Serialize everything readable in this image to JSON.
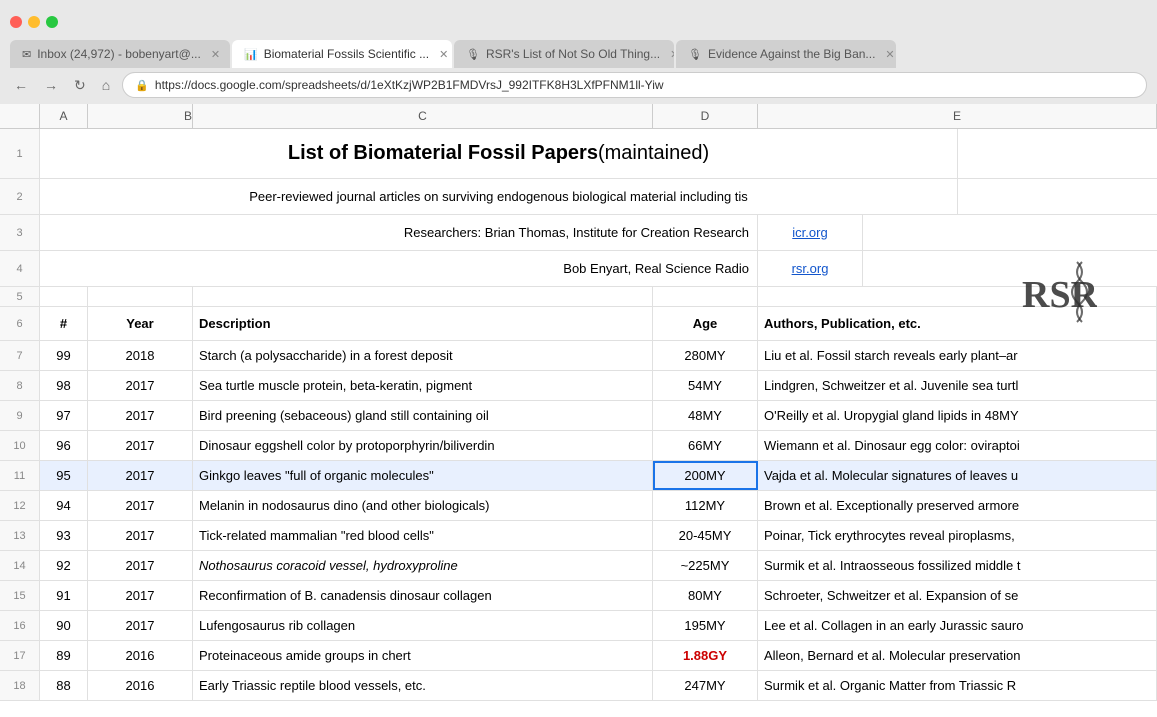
{
  "browser": {
    "traffic_lights": [
      "red",
      "yellow",
      "green"
    ],
    "tabs": [
      {
        "id": "gmail",
        "icon": "✉",
        "label": "Inbox (24,972) - bobenyart@...",
        "active": false
      },
      {
        "id": "biomaterial",
        "icon": "📊",
        "label": "Biomaterial Fossils Scientific ...",
        "active": true
      },
      {
        "id": "rsr-list",
        "icon": "🎙",
        "label": "RSR's List of Not So Old Thing...",
        "active": false
      },
      {
        "id": "evidence",
        "icon": "🎙",
        "label": "Evidence Against the Big Ban...",
        "active": false
      }
    ],
    "url": "https://docs.google.com/spreadsheets/d/1eXtKzjWP2B1FMDVrsJ_992ITFK8H3LXfPFNM1ll-Yiw"
  },
  "spreadsheet": {
    "col_headers": [
      "A",
      "B",
      "C",
      "D",
      "E"
    ],
    "title_bold": "List of Biomaterial Fossil Papers",
    "title_normal": " (maintained)",
    "subtitle": "Peer-reviewed journal articles on surviving endogenous biological material including tis",
    "researcher1": "Researchers: Brian Thomas, Institute for Creation Research",
    "researcher1_link": "icr.org",
    "researcher2": "Bob Enyart, Real Science Radio",
    "researcher2_link": "rsr.org",
    "col6_labels": [
      "#",
      "Year",
      "Description",
      "Age",
      "Authors, Publication, etc."
    ],
    "rows": [
      {
        "row": 7,
        "num": 99,
        "year": "2018",
        "desc": "Starch (a polysaccharide) in a forest deposit",
        "age": "280MY",
        "age_color": "black",
        "authors": "Liu et al. Fossil starch reveals early plant–ar"
      },
      {
        "row": 8,
        "num": 98,
        "year": "2017",
        "desc": "Sea turtle muscle protein, beta-keratin, pigment",
        "age": "54MY",
        "age_color": "black",
        "authors": "Lindgren, Schweitzer et al. Juvenile sea turtl"
      },
      {
        "row": 9,
        "num": 97,
        "year": "2017",
        "desc": "Bird preening (sebaceous) gland still containing oil",
        "age": "48MY",
        "age_color": "black",
        "authors": "O'Reilly et al. Uropygial gland lipids in 48MY"
      },
      {
        "row": 10,
        "num": 96,
        "year": "2017",
        "desc": "Dinosaur eggshell color by protoporphyrin/biliverdin",
        "age": "66MY",
        "age_color": "black",
        "authors": "Wiemann et al. Dinosaur egg color: oviraptoi"
      },
      {
        "row": 11,
        "num": 95,
        "year": "2017",
        "desc": "Ginkgo leaves \"full of organic molecules\"",
        "age": "200MY",
        "age_color": "black",
        "authors": "Vajda et al. Molecular signatures of leaves u",
        "selected": true
      },
      {
        "row": 12,
        "num": 94,
        "year": "2017",
        "desc": "Melanin in nodosaurus dino (and other biologicals)",
        "age": "112MY",
        "age_color": "black",
        "authors": "Brown et al. Exceptionally preserved armore"
      },
      {
        "row": 13,
        "num": 93,
        "year": "2017",
        "desc": "Tick-related mammalian \"red blood cells\"",
        "age": "20-45MY",
        "age_color": "black",
        "authors": "Poinar, Tick erythrocytes reveal piroplasms,"
      },
      {
        "row": 14,
        "num": 92,
        "year": "2017",
        "desc": "Nothosaurus coracoid vessel, hydroxyproline",
        "age": "~225MY",
        "age_color": "black",
        "authors": "Surmik et al. Intraosseous fossilized middle t"
      },
      {
        "row": 15,
        "num": 91,
        "year": "2017",
        "desc": "Reconfirmation of B. canadensis dinosaur collagen",
        "age": "80MY",
        "age_color": "black",
        "authors": "Schroeter, Schweitzer et al. Expansion of se"
      },
      {
        "row": 16,
        "num": 90,
        "year": "2017",
        "desc": "Lufengosaurus rib collagen",
        "age": "195MY",
        "age_color": "black",
        "authors": "Lee et al. Collagen in an early Jurassic sauro"
      },
      {
        "row": 17,
        "num": 89,
        "year": "2016",
        "desc": "Proteinaceous amide groups in chert",
        "age": "1.88GY",
        "age_color": "red",
        "authors": "Alleon, Bernard et al. Molecular preservation"
      },
      {
        "row": 18,
        "num": 88,
        "year": "2016",
        "desc": "Early Triassic reptile blood vessels, etc.",
        "age": "247MY",
        "age_color": "black",
        "authors": "Surmik et al. Organic Matter from Triassic R"
      }
    ]
  }
}
